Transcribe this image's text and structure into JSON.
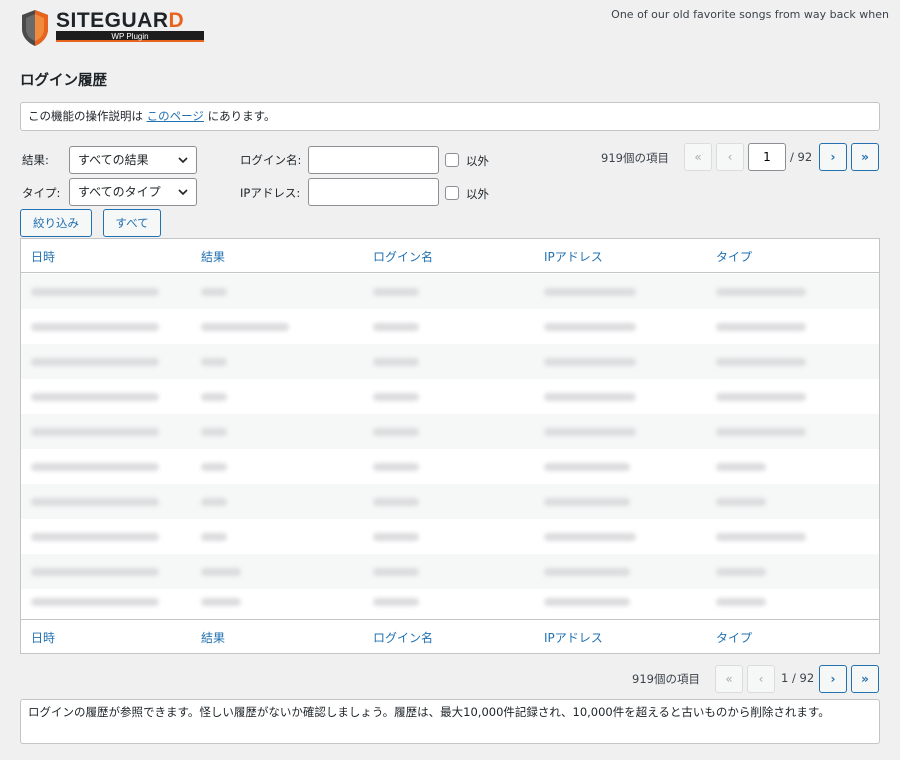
{
  "brand": {
    "name_main": "SITEGUAR",
    "name_accent": "D",
    "sub": "WP Plugin",
    "accent_color": "#e8641e"
  },
  "tagline": "One of our old favorite songs from way back when",
  "page_title": "ログイン履歴",
  "notice": {
    "prefix": "この機能の操作説明は ",
    "link": "このページ",
    "suffix": " にあります。"
  },
  "filters": {
    "result_label": "結果:",
    "result_value": "すべての結果",
    "type_label": "タイプ:",
    "type_value": "すべてのタイプ",
    "login_label": "ログイン名:",
    "login_value": "",
    "ip_label": "IPアドレス:",
    "ip_value": "",
    "except_label": "以外",
    "filter_button": "絞り込み",
    "all_button": "すべて"
  },
  "pagination": {
    "count": "919個の項目",
    "first": "«",
    "prev": "‹",
    "next": "›",
    "last": "»",
    "current": "1",
    "total": "/ 92",
    "bottom_page": "1 / 92"
  },
  "table": {
    "columns": [
      "日時",
      "結果",
      "ログイン名",
      "IPアドレス",
      "タイプ"
    ]
  },
  "description": "ログインの履歴が参照できます。怪しい履歴がないか確認しましょう。履歴は、最大10,000件記録され、10,000件を超えると古いものから削除されます。"
}
